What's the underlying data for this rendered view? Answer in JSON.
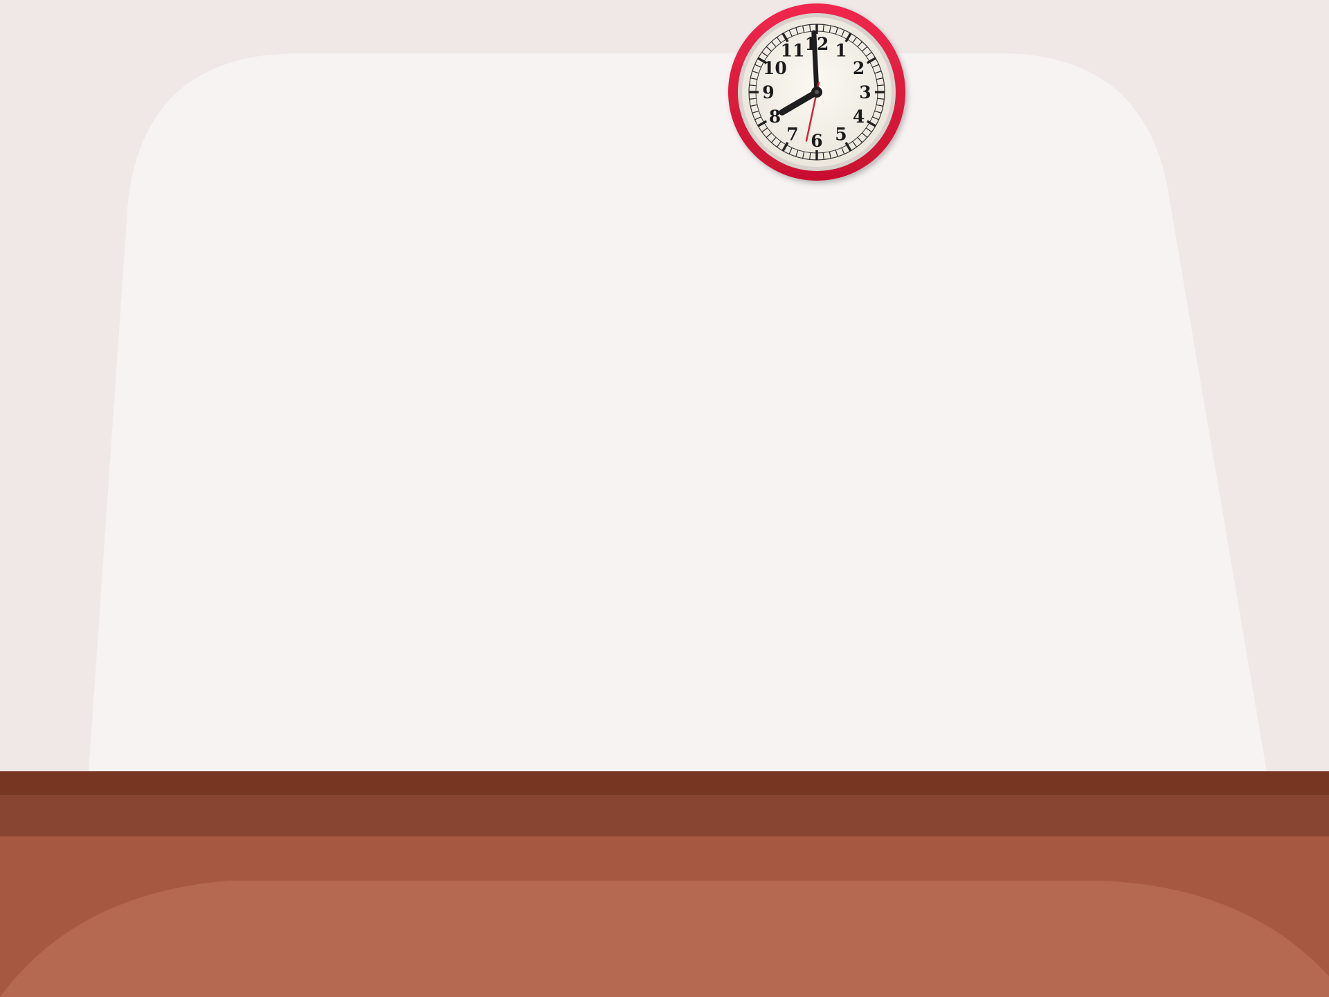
{
  "scene": {
    "colors": {
      "wall": "#EFE8E6",
      "board": "#F6F3F2",
      "trim_dark": "#773622",
      "trim_mid": "#874532",
      "floor": "#A65840",
      "floor_highlight": "#B56950",
      "clock_rim": "#E0183D",
      "clock_face": "#F5F2EA",
      "clock_hands": "#1E1E1E",
      "second_hand": "#D0243A"
    }
  },
  "clock": {
    "numerals": [
      "12",
      "1",
      "2",
      "3",
      "4",
      "5",
      "6",
      "7",
      "8",
      "9",
      "10",
      "11"
    ],
    "time": {
      "hour": 7,
      "minute": 59,
      "second": 32
    }
  }
}
